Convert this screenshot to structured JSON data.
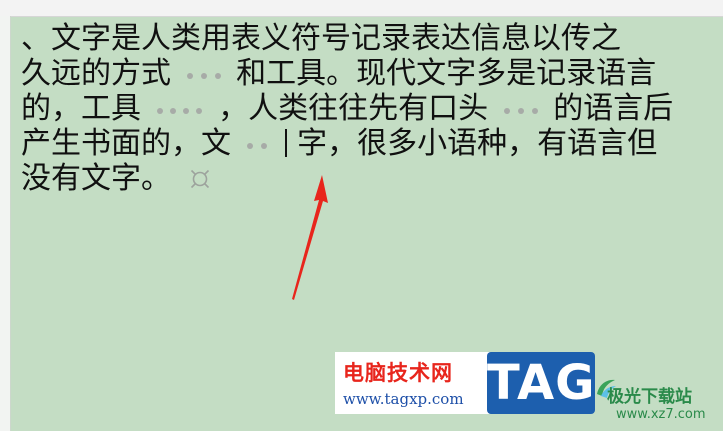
{
  "document": {
    "line1": "、文字是人类用表义符号记录表达信息以传之",
    "line2_a": "久远的方式",
    "line2_b": "和工具。现代文字多是记录语言",
    "line3_a": "的，工具",
    "line3_b": "，人类往往先有口头",
    "line3_c": "的语言后",
    "line4_a": "产生书面的，文",
    "line4_b": "字，很多小语种，有语言但",
    "line5": "没有文字。"
  },
  "colors": {
    "page_background": "#c4ddc4",
    "space_marker": "#a7aba7",
    "arrow": "#e8251c"
  },
  "icons": {
    "space_marker": "middle-dot-space-mark",
    "paragraph_mark": "paragraph-end-mark",
    "annotation_arrow": "red-arrow"
  },
  "watermark": {
    "site_name": "电脑技术网",
    "site_url": "www.tagxp.com",
    "tag_text": "TAG",
    "brand_name": "极光下载站",
    "brand_url": "www.xz7.com"
  }
}
